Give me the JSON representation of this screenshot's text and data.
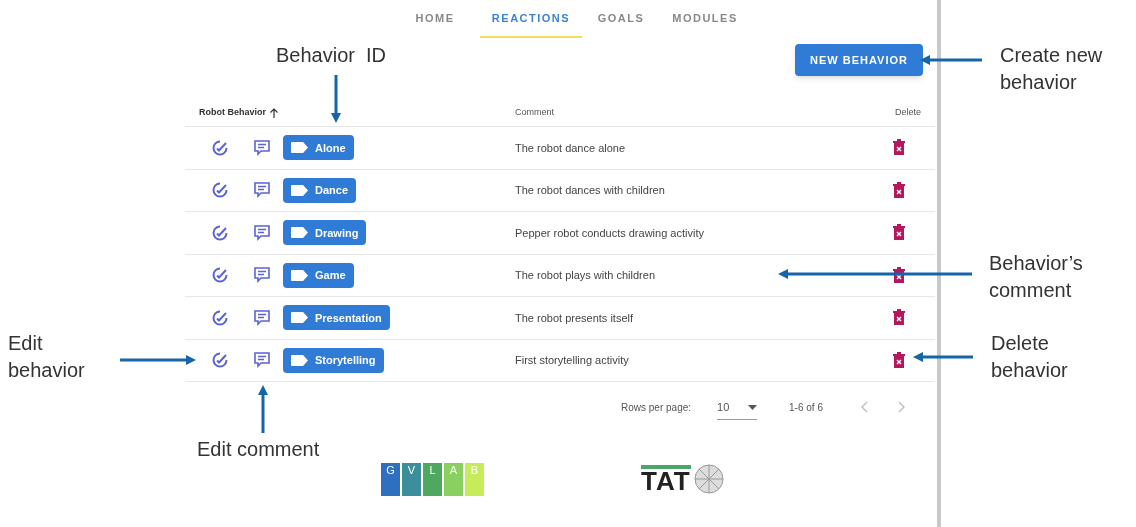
{
  "nav": {
    "tabs": [
      {
        "label": "HOME",
        "selected": false
      },
      {
        "label": "REACTIONS",
        "selected": true
      },
      {
        "label": "GOALS",
        "selected": false
      },
      {
        "label": "MODULES",
        "selected": false
      }
    ]
  },
  "new_button": "NEW BEHAVIOR",
  "table": {
    "columns": [
      {
        "label": "Robot Behavior",
        "sort_ascending": true
      },
      {
        "label": "Comment"
      },
      {
        "label": "Delete"
      }
    ],
    "rows": [
      {
        "behavior": "Alone",
        "comment": "The robot dance alone"
      },
      {
        "behavior": "Dance",
        "comment": "The robot dances with children"
      },
      {
        "behavior": "Drawing",
        "comment": "Pepper robot conducts drawing activity"
      },
      {
        "behavior": "Game",
        "comment": "The robot plays with children"
      },
      {
        "behavior": "Presentation",
        "comment": "The robot presents itself"
      },
      {
        "behavior": "Storytelling",
        "comment": "First storytelling activity"
      }
    ]
  },
  "pagination": {
    "rows_per_page_label": "Rows per page:",
    "rows_per_page": "10",
    "range": "1-6 of 6"
  },
  "logos": {
    "gvlab": [
      "G",
      "V",
      "L",
      "A",
      "B"
    ],
    "tat": "TAT"
  },
  "annotations": [
    {
      "text": "Behavior  ID",
      "kind": "down"
    },
    {
      "text": "Create new behavior",
      "kind": "left"
    },
    {
      "text": "Behavior’s comment",
      "kind": "left"
    },
    {
      "text": "Edit behavior",
      "kind": "right"
    },
    {
      "text": "Delete behavior",
      "kind": "left"
    },
    {
      "text": "Edit comment",
      "kind": "up"
    }
  ]
}
